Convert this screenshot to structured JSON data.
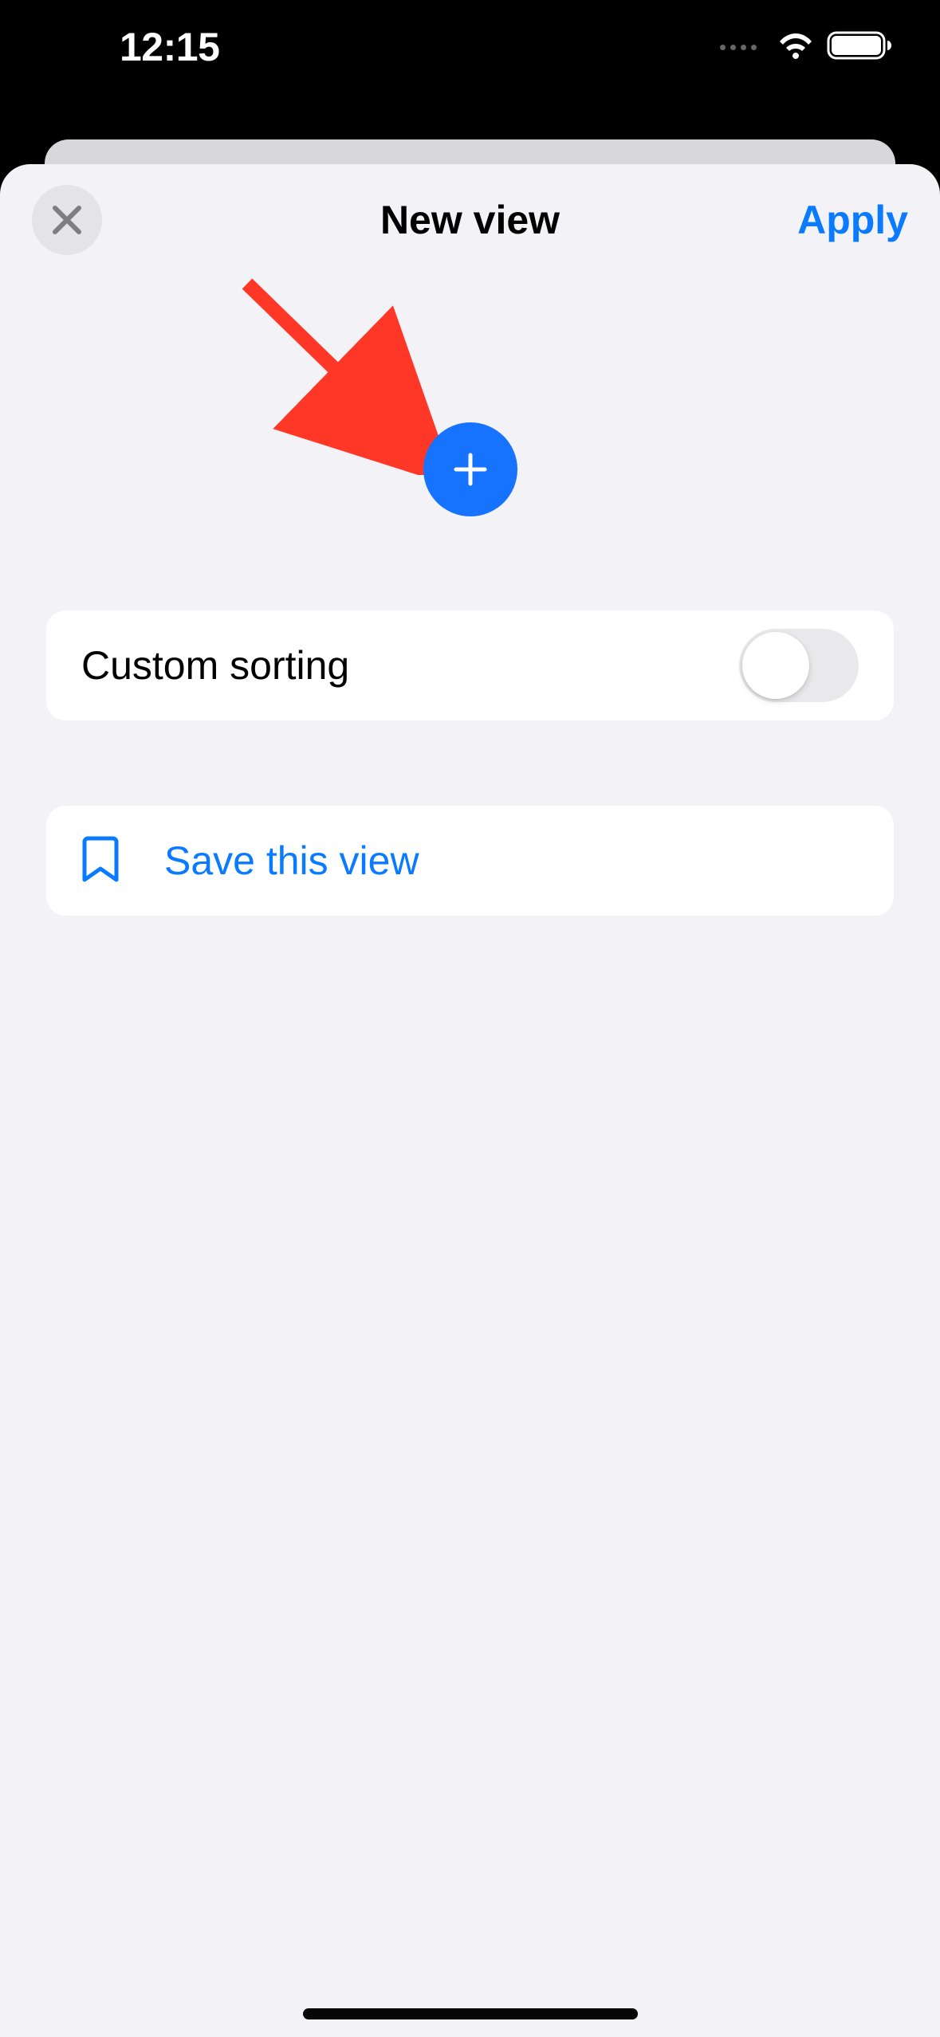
{
  "status_bar": {
    "time": "12:15"
  },
  "sheet": {
    "title": "New view",
    "apply_label": "Apply"
  },
  "sorting": {
    "label": "Custom sorting",
    "enabled": false
  },
  "save": {
    "label": "Save this view"
  },
  "colors": {
    "accent": "#0a7aff",
    "button_blue": "#1673ff",
    "sheet_bg": "#f2f2f7",
    "arrow": "#ff3726"
  }
}
